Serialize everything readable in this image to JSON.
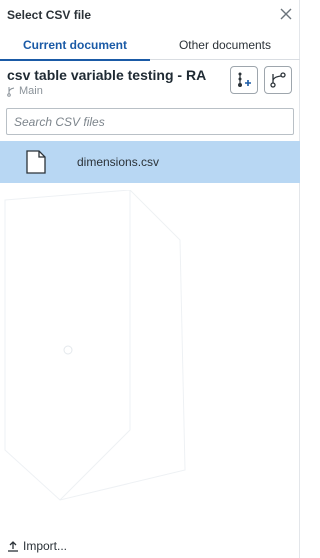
{
  "dialog": {
    "title": "Select CSV file"
  },
  "tabs": [
    {
      "label": "Current document",
      "active": true
    },
    {
      "label": "Other documents",
      "active": false
    }
  ],
  "document": {
    "title": "csv table variable testing - RA",
    "branch": "Main"
  },
  "search": {
    "placeholder": "Search CSV files",
    "value": ""
  },
  "files": [
    {
      "name": "dimensions.csv",
      "selected": true
    }
  ],
  "footer": {
    "import_label": "Import..."
  },
  "colors": {
    "accent": "#1a5aa6",
    "selected_row": "#b8d7f3",
    "border": "#b9c0c6"
  },
  "icons": {
    "close": "close-icon",
    "branch": "branch-icon",
    "insert": "insert-icon",
    "version_graph": "version-graph-icon",
    "file": "file-icon",
    "import": "upload-icon"
  }
}
